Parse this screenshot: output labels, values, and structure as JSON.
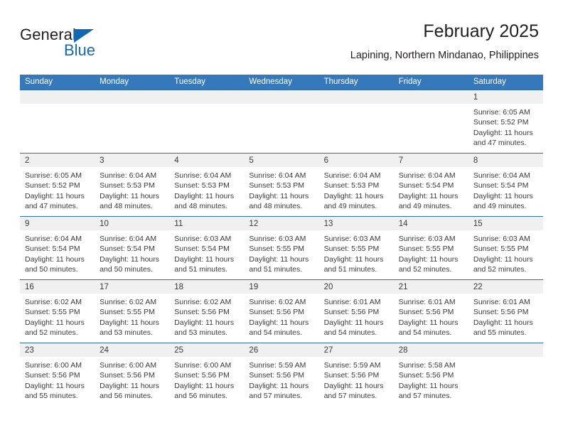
{
  "brand": {
    "name_part1": "General",
    "name_part2": "Blue",
    "triangle_color": "#1268b3"
  },
  "header": {
    "title": "February 2025",
    "subtitle": "Lapining, Northern Mindanao, Philippines"
  },
  "theme": {
    "header_blue": "#3579bc",
    "row_divider": "#2f6fae",
    "day_strip": "#f0f0f0",
    "text": "#3a3a3a"
  },
  "weekdays": [
    "Sunday",
    "Monday",
    "Tuesday",
    "Wednesday",
    "Thursday",
    "Friday",
    "Saturday"
  ],
  "weeks": [
    [
      {
        "day": "",
        "sunrise": "",
        "sunset": "",
        "daylight1": "",
        "daylight2": ""
      },
      {
        "day": "",
        "sunrise": "",
        "sunset": "",
        "daylight1": "",
        "daylight2": ""
      },
      {
        "day": "",
        "sunrise": "",
        "sunset": "",
        "daylight1": "",
        "daylight2": ""
      },
      {
        "day": "",
        "sunrise": "",
        "sunset": "",
        "daylight1": "",
        "daylight2": ""
      },
      {
        "day": "",
        "sunrise": "",
        "sunset": "",
        "daylight1": "",
        "daylight2": ""
      },
      {
        "day": "",
        "sunrise": "",
        "sunset": "",
        "daylight1": "",
        "daylight2": ""
      },
      {
        "day": "1",
        "sunrise": "Sunrise: 6:05 AM",
        "sunset": "Sunset: 5:52 PM",
        "daylight1": "Daylight: 11 hours",
        "daylight2": "and 47 minutes."
      }
    ],
    [
      {
        "day": "2",
        "sunrise": "Sunrise: 6:05 AM",
        "sunset": "Sunset: 5:52 PM",
        "daylight1": "Daylight: 11 hours",
        "daylight2": "and 47 minutes."
      },
      {
        "day": "3",
        "sunrise": "Sunrise: 6:04 AM",
        "sunset": "Sunset: 5:53 PM",
        "daylight1": "Daylight: 11 hours",
        "daylight2": "and 48 minutes."
      },
      {
        "day": "4",
        "sunrise": "Sunrise: 6:04 AM",
        "sunset": "Sunset: 5:53 PM",
        "daylight1": "Daylight: 11 hours",
        "daylight2": "and 48 minutes."
      },
      {
        "day": "5",
        "sunrise": "Sunrise: 6:04 AM",
        "sunset": "Sunset: 5:53 PM",
        "daylight1": "Daylight: 11 hours",
        "daylight2": "and 48 minutes."
      },
      {
        "day": "6",
        "sunrise": "Sunrise: 6:04 AM",
        "sunset": "Sunset: 5:53 PM",
        "daylight1": "Daylight: 11 hours",
        "daylight2": "and 49 minutes."
      },
      {
        "day": "7",
        "sunrise": "Sunrise: 6:04 AM",
        "sunset": "Sunset: 5:54 PM",
        "daylight1": "Daylight: 11 hours",
        "daylight2": "and 49 minutes."
      },
      {
        "day": "8",
        "sunrise": "Sunrise: 6:04 AM",
        "sunset": "Sunset: 5:54 PM",
        "daylight1": "Daylight: 11 hours",
        "daylight2": "and 49 minutes."
      }
    ],
    [
      {
        "day": "9",
        "sunrise": "Sunrise: 6:04 AM",
        "sunset": "Sunset: 5:54 PM",
        "daylight1": "Daylight: 11 hours",
        "daylight2": "and 50 minutes."
      },
      {
        "day": "10",
        "sunrise": "Sunrise: 6:04 AM",
        "sunset": "Sunset: 5:54 PM",
        "daylight1": "Daylight: 11 hours",
        "daylight2": "and 50 minutes."
      },
      {
        "day": "11",
        "sunrise": "Sunrise: 6:03 AM",
        "sunset": "Sunset: 5:54 PM",
        "daylight1": "Daylight: 11 hours",
        "daylight2": "and 51 minutes."
      },
      {
        "day": "12",
        "sunrise": "Sunrise: 6:03 AM",
        "sunset": "Sunset: 5:55 PM",
        "daylight1": "Daylight: 11 hours",
        "daylight2": "and 51 minutes."
      },
      {
        "day": "13",
        "sunrise": "Sunrise: 6:03 AM",
        "sunset": "Sunset: 5:55 PM",
        "daylight1": "Daylight: 11 hours",
        "daylight2": "and 51 minutes."
      },
      {
        "day": "14",
        "sunrise": "Sunrise: 6:03 AM",
        "sunset": "Sunset: 5:55 PM",
        "daylight1": "Daylight: 11 hours",
        "daylight2": "and 52 minutes."
      },
      {
        "day": "15",
        "sunrise": "Sunrise: 6:03 AM",
        "sunset": "Sunset: 5:55 PM",
        "daylight1": "Daylight: 11 hours",
        "daylight2": "and 52 minutes."
      }
    ],
    [
      {
        "day": "16",
        "sunrise": "Sunrise: 6:02 AM",
        "sunset": "Sunset: 5:55 PM",
        "daylight1": "Daylight: 11 hours",
        "daylight2": "and 52 minutes."
      },
      {
        "day": "17",
        "sunrise": "Sunrise: 6:02 AM",
        "sunset": "Sunset: 5:55 PM",
        "daylight1": "Daylight: 11 hours",
        "daylight2": "and 53 minutes."
      },
      {
        "day": "18",
        "sunrise": "Sunrise: 6:02 AM",
        "sunset": "Sunset: 5:56 PM",
        "daylight1": "Daylight: 11 hours",
        "daylight2": "and 53 minutes."
      },
      {
        "day": "19",
        "sunrise": "Sunrise: 6:02 AM",
        "sunset": "Sunset: 5:56 PM",
        "daylight1": "Daylight: 11 hours",
        "daylight2": "and 54 minutes."
      },
      {
        "day": "20",
        "sunrise": "Sunrise: 6:01 AM",
        "sunset": "Sunset: 5:56 PM",
        "daylight1": "Daylight: 11 hours",
        "daylight2": "and 54 minutes."
      },
      {
        "day": "21",
        "sunrise": "Sunrise: 6:01 AM",
        "sunset": "Sunset: 5:56 PM",
        "daylight1": "Daylight: 11 hours",
        "daylight2": "and 54 minutes."
      },
      {
        "day": "22",
        "sunrise": "Sunrise: 6:01 AM",
        "sunset": "Sunset: 5:56 PM",
        "daylight1": "Daylight: 11 hours",
        "daylight2": "and 55 minutes."
      }
    ],
    [
      {
        "day": "23",
        "sunrise": "Sunrise: 6:00 AM",
        "sunset": "Sunset: 5:56 PM",
        "daylight1": "Daylight: 11 hours",
        "daylight2": "and 55 minutes."
      },
      {
        "day": "24",
        "sunrise": "Sunrise: 6:00 AM",
        "sunset": "Sunset: 5:56 PM",
        "daylight1": "Daylight: 11 hours",
        "daylight2": "and 56 minutes."
      },
      {
        "day": "25",
        "sunrise": "Sunrise: 6:00 AM",
        "sunset": "Sunset: 5:56 PM",
        "daylight1": "Daylight: 11 hours",
        "daylight2": "and 56 minutes."
      },
      {
        "day": "26",
        "sunrise": "Sunrise: 5:59 AM",
        "sunset": "Sunset: 5:56 PM",
        "daylight1": "Daylight: 11 hours",
        "daylight2": "and 57 minutes."
      },
      {
        "day": "27",
        "sunrise": "Sunrise: 5:59 AM",
        "sunset": "Sunset: 5:56 PM",
        "daylight1": "Daylight: 11 hours",
        "daylight2": "and 57 minutes."
      },
      {
        "day": "28",
        "sunrise": "Sunrise: 5:58 AM",
        "sunset": "Sunset: 5:56 PM",
        "daylight1": "Daylight: 11 hours",
        "daylight2": "and 57 minutes."
      },
      {
        "day": "",
        "sunrise": "",
        "sunset": "",
        "daylight1": "",
        "daylight2": ""
      }
    ]
  ]
}
